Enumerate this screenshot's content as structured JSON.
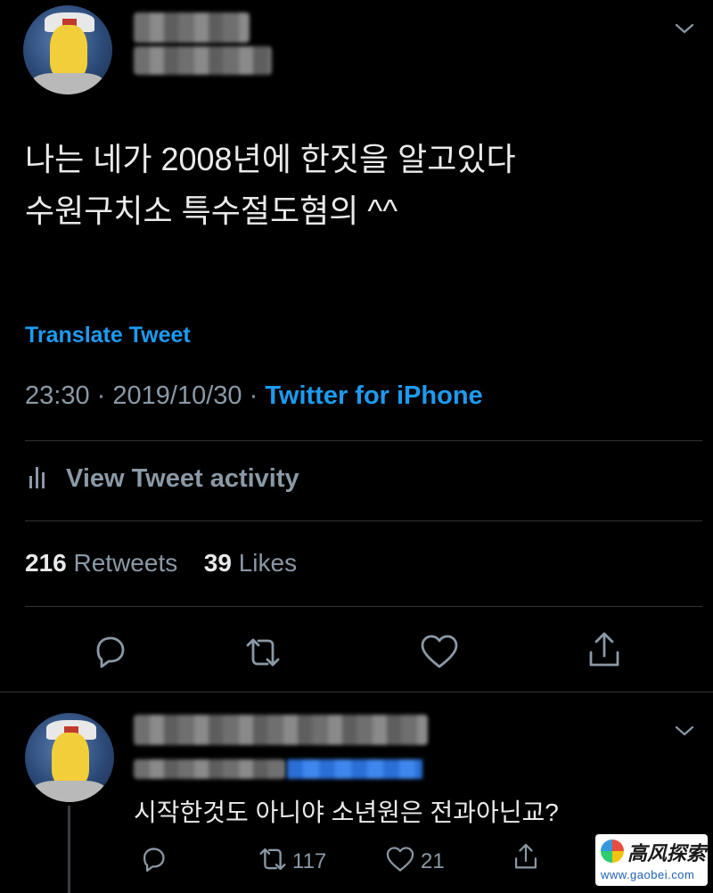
{
  "tweet": {
    "text_line1": "나는 네가 2008년에 한짓을 알고있다",
    "text_line2": "수원구치소 특수절도혐의 ^^",
    "translate": "Translate Tweet",
    "time": "23:30",
    "sep1": "·",
    "date": "2019/10/30",
    "sep2": "·",
    "source": "Twitter for iPhone",
    "activity": "View Tweet activity",
    "retweets_count": "216",
    "retweets_label": "Retweets",
    "likes_count": "39",
    "likes_label": "Likes"
  },
  "reply": {
    "text": "시작한것도 아니야 소년원은 전과아닌교?",
    "retweet_count": "117",
    "like_count": "21"
  },
  "watermark": {
    "title": "高风探索",
    "url": "www.gaobei.com"
  },
  "colors": {
    "background": "#000000",
    "link": "#1d9bf0",
    "muted": "#8b98a5",
    "divider": "#2f3336"
  }
}
